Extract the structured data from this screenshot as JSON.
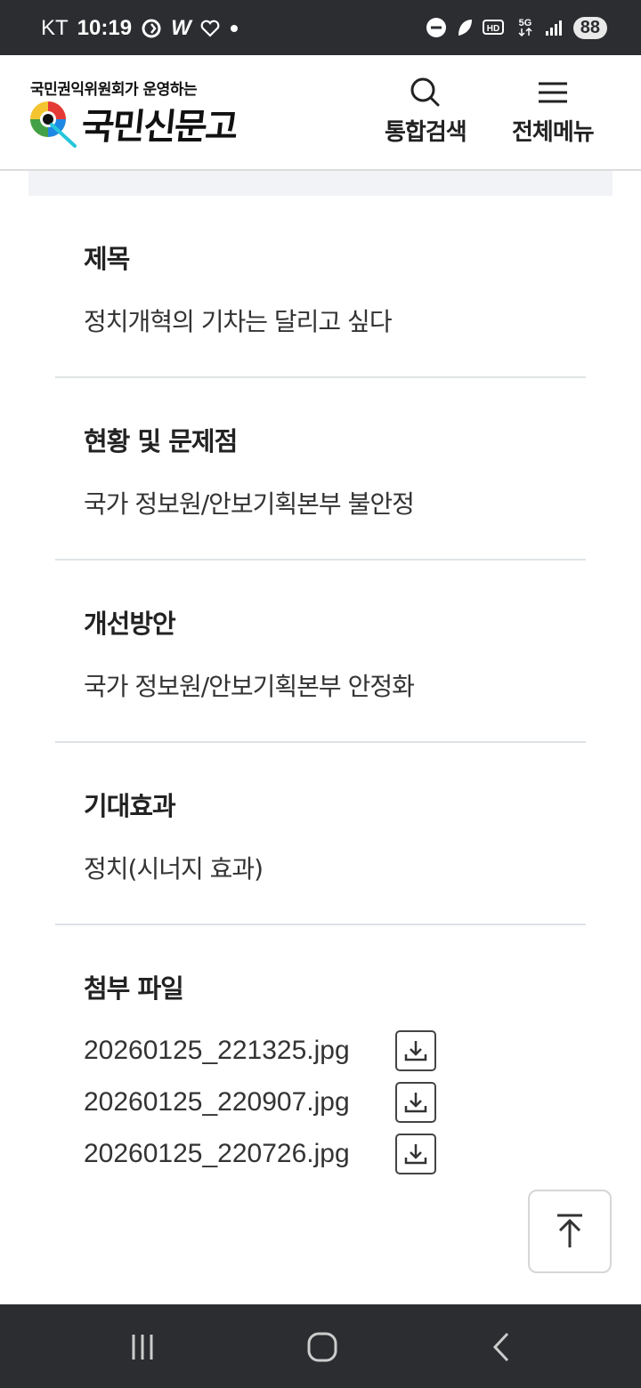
{
  "status_bar": {
    "carrier": "KT",
    "time": "10:19",
    "battery": "88",
    "icons": [
      "sync-icon",
      "w-app-icon",
      "heart-icon",
      "dot-icon",
      "dnd-icon",
      "leaf-icon",
      "hd-icon",
      "5g-icon",
      "signal-icon",
      "battery-icon"
    ]
  },
  "header": {
    "logo_subtitle": "국민권익위원회가 운영하는",
    "logo_title": "국민신문고",
    "search_label": "통합검색",
    "menu_label": "전체메뉴"
  },
  "sections": [
    {
      "title": "제목",
      "value": "정치개혁의 기차는 달리고 싶다"
    },
    {
      "title": "현황 및 문제점",
      "value": "국가 정보원/안보기획본부 불안정"
    },
    {
      "title": "개선방안",
      "value": "국가 정보원/안보기획본부 안정화"
    },
    {
      "title": "기대효과",
      "value": "정치(시너지 효과)"
    }
  ],
  "attachments": {
    "title": "첨부 파일",
    "files": [
      "20260125_221325.jpg",
      "20260125_220907.jpg",
      "20260125_220726.jpg"
    ]
  },
  "colors": {
    "status_bg": "#2b2d30",
    "divider": "#dfe3e6",
    "band": "#f2f3f6"
  }
}
